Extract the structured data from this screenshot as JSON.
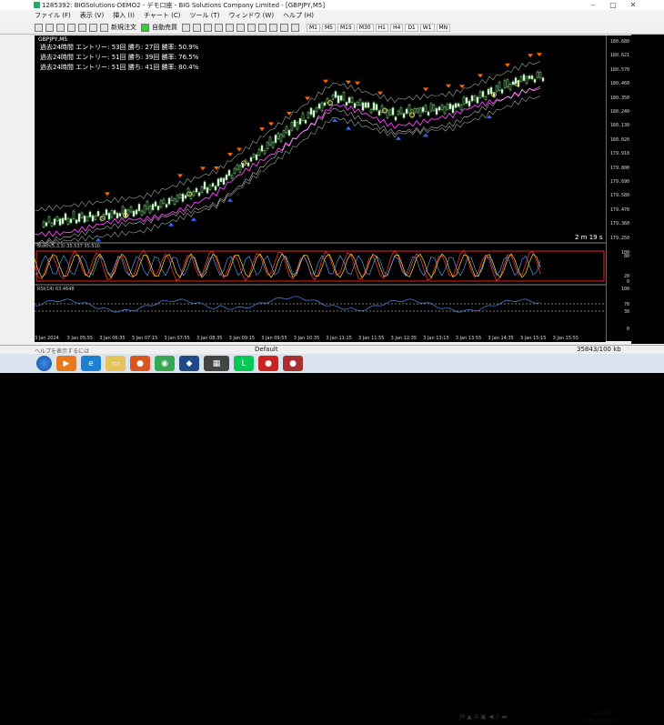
{
  "window": {
    "title": "1285392: BIGSolutions-DEMO2 - デモ口座 - BIG Solutions Company Limited - [GBPJPY,M5]"
  },
  "menu": [
    "ファイル (F)",
    "表示 (V)",
    "挿入 (I)",
    "チャート (C)",
    "ツール (T)",
    "ウィンドウ (W)",
    "ヘルプ (H)"
  ],
  "toolbar": {
    "new_order": "新規注文",
    "auto_trade": "自動売買",
    "timeframes": [
      "M1",
      "M5",
      "M15",
      "M30",
      "H1",
      "H4",
      "D1",
      "W1",
      "MN"
    ]
  },
  "chart": {
    "symbol": "GBPJPY,M5",
    "stats": [
      "過去24時間  エントリー: 53回  勝ち: 27回  勝率: 50.9%",
      "過去24時間  エントリー: 51回  勝ち: 39回  勝率: 76.5%",
      "過去24時間  エントリー: 51回  勝ち: 41回  勝率: 80.4%"
    ],
    "timer": "2 m 19 s",
    "stoch_label": "Stoch(5,3,3) 35.537 35.510",
    "rsi_label": "RSI(14) 63.4648",
    "price_labels": [
      "180.680",
      "180.621",
      "180.570",
      "180.460",
      "180.350",
      "180.240",
      "180.130",
      "180.020",
      "179.910",
      "179.800",
      "179.690",
      "179.580",
      "179.470",
      "179.360",
      "179.250"
    ],
    "stoch_scale": [
      "100",
      "80",
      "20",
      "0"
    ],
    "rsi_scale": [
      "100",
      "70",
      "30",
      "0"
    ],
    "time_labels": [
      "3 Jan 2024",
      "3 Jan 05:55",
      "3 Jan 06:35",
      "3 Jan 07:15",
      "3 Jan 07:55",
      "3 Jan 08:35",
      "3 Jan 09:15",
      "3 Jan 09:55",
      "3 Jan 10:35",
      "3 Jan 11:15",
      "3 Jan 11:55",
      "3 Jan 12:35",
      "3 Jan 13:15",
      "3 Jan 13:55",
      "3 Jan 14:35",
      "3 Jan 15:15",
      "3 Jan 15:55"
    ]
  },
  "statusbar": {
    "left": "ヘルプを表示するには",
    "profile": "Default",
    "traffic": "35843/100 kb"
  },
  "taskbar": {
    "time": "22:57",
    "date": "2024/01/03"
  }
}
